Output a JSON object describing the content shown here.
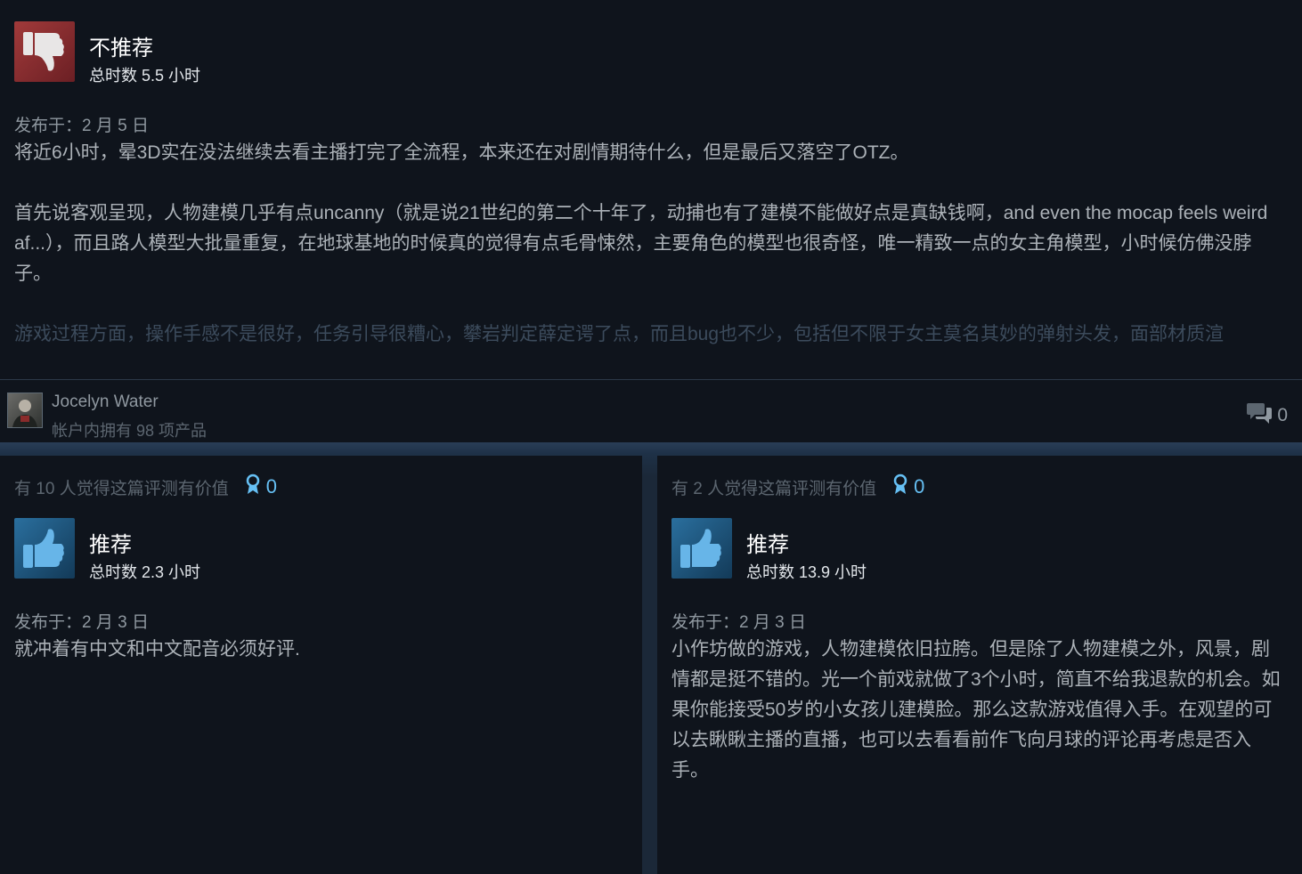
{
  "colors": {
    "background": "#1b2838",
    "card": "#0f141c",
    "accent_blue": "#66c0f4",
    "not_recommended_red": "#a13a3a",
    "recommended_blue": "#2a6f9e"
  },
  "review_top": {
    "rating": "不推荐",
    "rating_icon": "thumbs-down-icon",
    "hours": "总时数 5.5 小时",
    "posted": "发布于：2 月 5 日",
    "paragraphs": [
      "将近6小时，晕3D实在没法继续去看主播打完了全流程，本来还在对剧情期待什么，但是最后又落空了OTZ。",
      "首先说客观呈现，人物建模几乎有点uncanny（就是说21世纪的第二个十年了，动捕也有了建模不能做好点是真缺钱啊，and even the mocap feels weird af...），而且路人模型大批量重复，在地球基地的时候真的觉得有点毛骨悚然，主要角色的模型也很奇怪，唯一精致一点的女主角模型，小时候仿佛没脖子。",
      "游戏过程方面，操作手感不是很好，任务引导很糟心，攀岩判定薛定谔了点，而且bug也不少，包括但不限于女主莫名其妙的弹射头发，面部材质渲"
    ],
    "author": {
      "name": "Jocelyn Water",
      "products": "帐户内拥有 98 项产品",
      "avatar_icon": "avatar",
      "comments_icon": "comment-bubbles-icon",
      "comments_count": "0"
    }
  },
  "review_left": {
    "helpful": "有 10 人觉得这篇评测有价值",
    "award_icon": "award-ribbon-icon",
    "awards": "0",
    "rating": "推荐",
    "rating_icon": "thumbs-up-icon",
    "hours": "总时数 2.3 小时",
    "posted": "发布于：2 月 3 日",
    "text": "就冲着有中文和中文配音必须好评."
  },
  "review_right": {
    "helpful": "有 2 人觉得这篇评测有价值",
    "award_icon": "award-ribbon-icon",
    "awards": "0",
    "rating": "推荐",
    "rating_icon": "thumbs-up-icon",
    "hours": "总时数 13.9 小时",
    "posted": "发布于：2 月 3 日",
    "text": "小作坊做的游戏，人物建模依旧拉胯。但是除了人物建模之外，风景，剧情都是挺不错的。光一个前戏就做了3个小时，简直不给我退款的机会。如果你能接受50岁的小女孩儿建模脸。那么这款游戏值得入手。在观望的可以去瞅瞅主播的直播，也可以去看看前作飞向月球的评论再考虑是否入手。"
  }
}
